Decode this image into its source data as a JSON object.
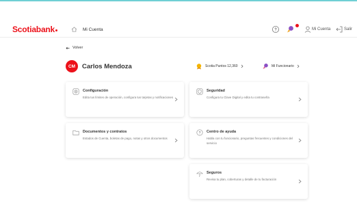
{
  "brand": {
    "logo_text": "Scotiabank",
    "accent_color": "#ec111a",
    "top_line_color": "#6fcfd4"
  },
  "header": {
    "title": "Mi Cuenta",
    "user_label": "Mi Cuenta",
    "exit_label": "Salir",
    "icons": [
      "home-icon",
      "help-icon",
      "notification-icon",
      "user-icon",
      "exit-icon"
    ]
  },
  "back": {
    "label": "Volver"
  },
  "profile": {
    "initials": "CM",
    "name": "Carlos Mendoza"
  },
  "badges": {
    "points": "Scotia Puntos 12,360",
    "manager": "Mi Funcionario"
  },
  "cards": [
    {
      "title": "Configuración",
      "description": "Edita tus límites de operación, configura tus tarjetas y notificaciones",
      "icon": "gear-icon"
    },
    {
      "title": "Seguridad",
      "description": "Configura tu Clave Digital y edita tu contraseña",
      "icon": "shield-icon"
    },
    {
      "title": "Documentos y contratos",
      "description": "Estados de Cuenta, boletas de pago, notas y otros documentos",
      "icon": "folder-icon"
    },
    {
      "title": "Centro de ayuda",
      "description": "Habla con tu funcionario, preguntas frecuentes y condiciones del servicio",
      "icon": "help-icon"
    },
    {
      "title": "Seguros",
      "description": "Revisa tu plan, coberturas y detalle de tu facturación",
      "icon": "umbrella-icon"
    }
  ]
}
